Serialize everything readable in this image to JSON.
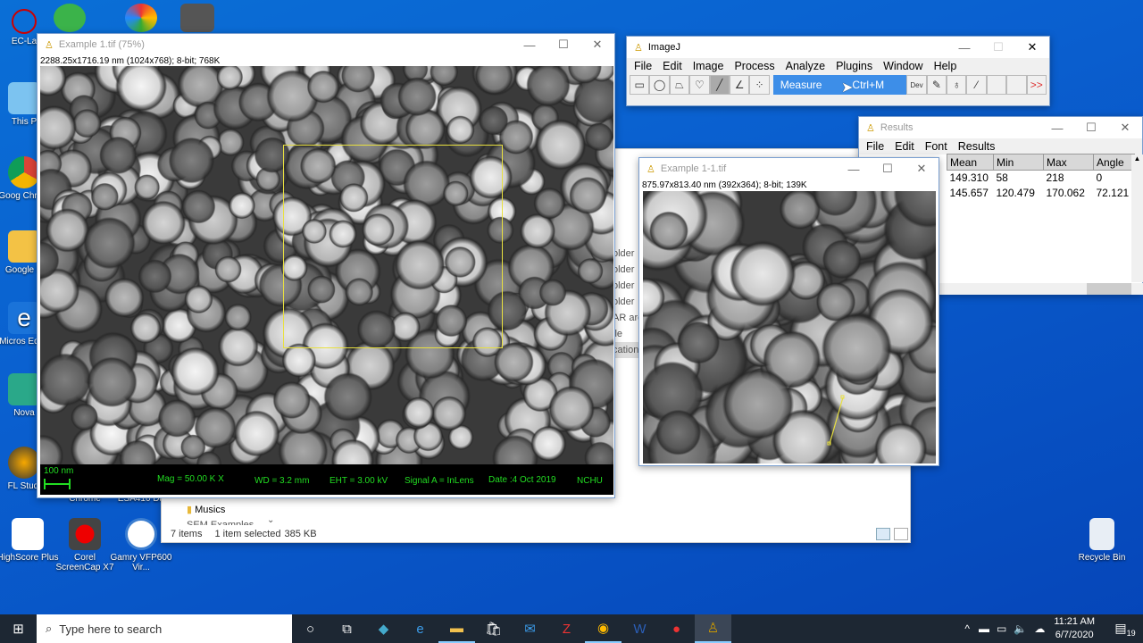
{
  "desktop": {
    "icons": [
      {
        "label": "EC-La"
      },
      {
        "label": "This P"
      },
      {
        "label": "Goog Chrom"
      },
      {
        "label": "Google D"
      },
      {
        "label": "Micros Edge"
      },
      {
        "label": "Nova"
      },
      {
        "label": "FL Studi"
      },
      {
        "label": "HighScore Plus"
      },
      {
        "label": "Corel ScreenCap X7"
      },
      {
        "label": "Gamry VFP600 Vir..."
      },
      {
        "label": "Chrome"
      },
      {
        "label": "ESA410 Da"
      },
      {
        "label": "Recycle Bin"
      }
    ]
  },
  "image_window": {
    "title": "Example 1.tif (75%)",
    "info": "2288.25x1716.19 nm (1024x768); 8-bit; 768K",
    "databar": {
      "scale": "100 nm",
      "mag": "Mag = 50.00 K X",
      "wd": "WD = 3.2 mm",
      "eht": "EHT = 3.00 kV",
      "signal": "Signal A = InLens",
      "date": "Date :4 Oct 2019",
      "org": "NCHU"
    }
  },
  "imagej": {
    "title": "ImageJ",
    "menu": [
      "File",
      "Edit",
      "Image",
      "Process",
      "Analyze",
      "Plugins",
      "Window",
      "Help"
    ],
    "status_command": "Measure",
    "status_shortcut": "Ctrl+M",
    "dev": "Dev",
    "more": ">>",
    "tools": [
      "rectangle-icon",
      "oval-icon",
      "polygon-icon",
      "freehand-icon",
      "line-icon",
      "angle-icon",
      "multipoint-icon"
    ]
  },
  "results": {
    "title": "Results",
    "menu": [
      "File",
      "Edit",
      "Font",
      "Results"
    ],
    "columns": [
      "Mean",
      "Min",
      "Max",
      "Angle"
    ],
    "rows": [
      [
        "149.310",
        "58",
        "218",
        "0"
      ],
      [
        "145.657",
        "120.479",
        "170.062",
        "72.121"
      ]
    ]
  },
  "crop_window": {
    "title": "Example 1-1.tif",
    "info": "875.97x813.40 nm (392x364); 8-bit; 139K"
  },
  "explorer": {
    "items": [
      "older",
      "older",
      "older",
      "older",
      "AR arc",
      "ile",
      "cation"
    ],
    "folder": "Musics",
    "folder2": "SEM Examples",
    "status_count": "7 items",
    "status_selected": "1 item selected",
    "status_size": "385 KB"
  },
  "taskbar": {
    "search_placeholder": "Type here to search",
    "time": "11:21 AM",
    "date": "6/7/2020",
    "notifications": "19"
  },
  "colors": {
    "accent": "#3d8ee8",
    "databar_text": "#22dd22",
    "roi": "#e8e040"
  }
}
